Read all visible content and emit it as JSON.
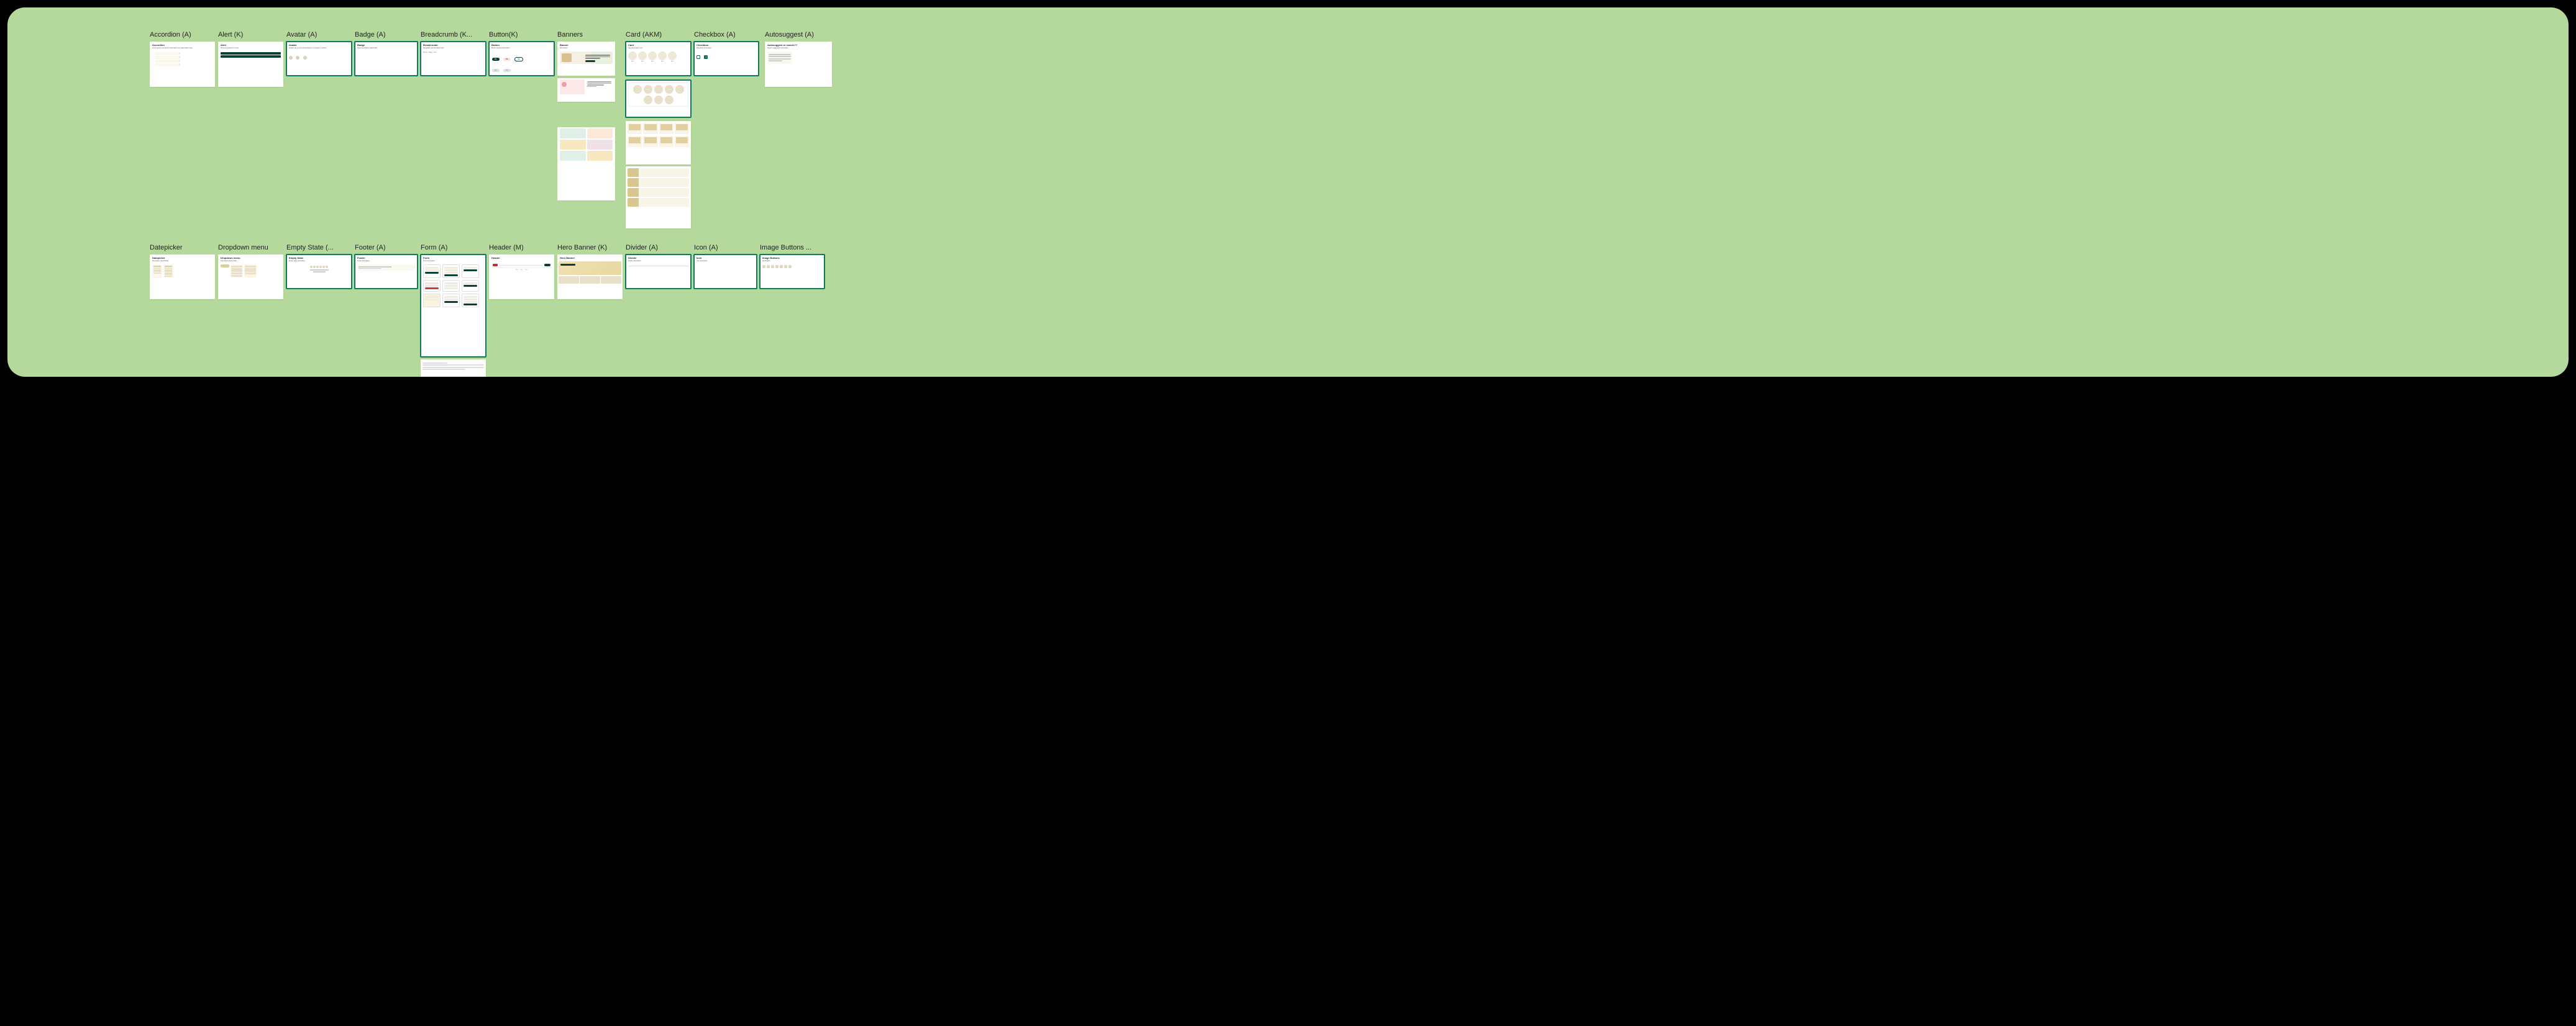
{
  "columns": [
    {
      "key": "accordion",
      "label": "Accordion (A)"
    },
    {
      "key": "alert",
      "label": "Alert (K)"
    },
    {
      "key": "avatar",
      "label": "Avatar (A)"
    },
    {
      "key": "badge",
      "label": "Badge (A)"
    },
    {
      "key": "breadcrumb",
      "label": "Breadcrumb (K..."
    },
    {
      "key": "button",
      "label": "Button(K)"
    },
    {
      "key": "banners",
      "label": "Banners"
    },
    {
      "key": "card",
      "label": "Card (AKM)"
    },
    {
      "key": "checkbox",
      "label": "Checkbox (A)"
    },
    {
      "key": "autosuggest",
      "label": "Autosuggest (A)"
    }
  ],
  "row2": [
    {
      "key": "datepicker",
      "label": "Datepicker"
    },
    {
      "key": "dropdown",
      "label": "Dropdown menu"
    },
    {
      "key": "empty",
      "label": "Empty State  (..."
    },
    {
      "key": "footer",
      "label": "Footer (A)"
    },
    {
      "key": "form",
      "label": "Form (A)"
    },
    {
      "key": "header",
      "label": "Header (M)"
    },
    {
      "key": "hero",
      "label": "Hero Banner (K)"
    },
    {
      "key": "divider",
      "label": "Divider (A)"
    },
    {
      "key": "icon",
      "label": "Icon (A)"
    },
    {
      "key": "imgbtn",
      "label": "Image Buttons ..."
    }
  ],
  "frames": {
    "accordion": {
      "title": "Accordion"
    },
    "alert": {
      "title": "Alert"
    },
    "avatar": {
      "title": "Avatar"
    },
    "badge": {
      "title": "Badge"
    },
    "breadcrumb": {
      "title": "Breadcrumb"
    },
    "button": {
      "title": "Button"
    },
    "banner": {
      "title": "Banner"
    },
    "card": {
      "title": "Card"
    },
    "checkbox": {
      "title": "Checkbox"
    },
    "autosuggest": {
      "title": "Autosuggest or search??"
    },
    "datepicker": {
      "title": "Datepicker"
    },
    "dropdown": {
      "title": "Dropdown menu"
    },
    "empty": {
      "title": "Empty State"
    },
    "footer": {
      "title": "Footer"
    },
    "form": {
      "title": "Form"
    },
    "header": {
      "title": "Header"
    },
    "hero": {
      "title": "Hero Banner"
    },
    "divider": {
      "title": "Divider"
    },
    "icon": {
      "title": "Icon"
    },
    "imgbtn": {
      "title": "Image Buttons"
    }
  },
  "colors": {
    "accent": "#0f7b5a",
    "darkgreen": "#0a4034",
    "canvas": "#b5d99c"
  }
}
